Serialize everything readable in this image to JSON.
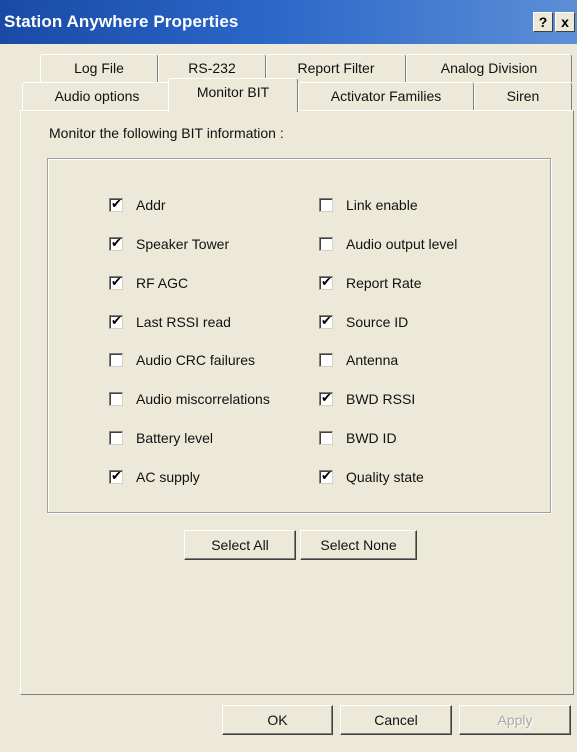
{
  "window": {
    "title": "Station Anywhere Properties",
    "help_glyph": "?",
    "close_glyph": "x"
  },
  "tabs": {
    "row1": [
      {
        "label": "Log File"
      },
      {
        "label": "RS-232"
      },
      {
        "label": "Report Filter"
      },
      {
        "label": "Analog Division"
      }
    ],
    "row2": [
      {
        "label": "Audio options"
      },
      {
        "label": "Monitor BIT",
        "selected": true
      },
      {
        "label": "Activator Families"
      },
      {
        "label": "Siren"
      }
    ]
  },
  "page": {
    "instruction": "Monitor the following BIT information :",
    "check_glyph": "✔",
    "left_column": [
      {
        "label": "Addr",
        "checked": true
      },
      {
        "label": "Speaker Tower",
        "checked": true
      },
      {
        "label": "RF AGC",
        "checked": true
      },
      {
        "label": "Last RSSI read",
        "checked": true
      },
      {
        "label": "Audio CRC failures",
        "checked": false
      },
      {
        "label": "Audio miscorrelations",
        "checked": false
      },
      {
        "label": "Battery level",
        "checked": false
      },
      {
        "label": "AC supply",
        "checked": true
      }
    ],
    "right_column": [
      {
        "label": "Link enable",
        "checked": false
      },
      {
        "label": "Audio output level",
        "checked": false
      },
      {
        "label": "Report Rate",
        "checked": true
      },
      {
        "label": "Source ID",
        "checked": true
      },
      {
        "label": "Antenna",
        "checked": false
      },
      {
        "label": "BWD RSSI",
        "checked": true
      },
      {
        "label": "BWD ID",
        "checked": false
      },
      {
        "label": "Quality state",
        "checked": true
      }
    ],
    "select_all_label": "Select All",
    "select_none_label": "Select None"
  },
  "footer": {
    "ok_label": "OK",
    "cancel_label": "Cancel",
    "apply_label": "Apply",
    "apply_enabled": false
  }
}
